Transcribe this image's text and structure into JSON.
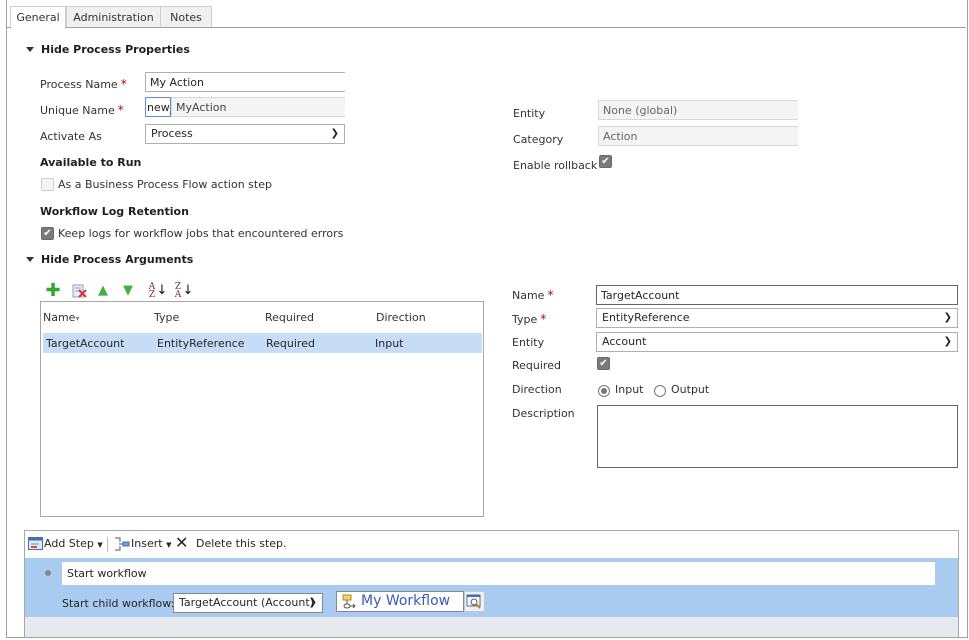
{
  "tabs": [
    {
      "label": "General",
      "active": true
    },
    {
      "label": "Administration",
      "active": false
    },
    {
      "label": "Notes",
      "active": false
    }
  ],
  "process_properties": {
    "section_title": "Hide Process Properties",
    "process_name_label": "Process Name",
    "process_name_value": "My Action",
    "unique_name_label": "Unique Name",
    "unique_name_prefix": "new_",
    "unique_name_value": "MyAction",
    "activate_as_label": "Activate As",
    "activate_as_value": "Process",
    "available_to_run_title": "Available to Run",
    "bpf_action_step_label": "As a Business Process Flow action step",
    "bpf_action_step_checked": false,
    "log_retention_title": "Workflow Log Retention",
    "keep_logs_label": "Keep logs for workflow jobs that encountered errors",
    "keep_logs_checked": true,
    "entity_label": "Entity",
    "entity_value": "None (global)",
    "category_label": "Category",
    "category_value": "Action",
    "enable_rollback_label": "Enable rollback",
    "enable_rollback_checked": true,
    "required_marker": "*"
  },
  "process_arguments": {
    "section_title": "Hide Process Arguments",
    "toolbar_icons": [
      "add-icon",
      "delete-icon",
      "move-up-icon",
      "move-down-icon",
      "sort-ascending-icon",
      "sort-descending-icon"
    ],
    "columns": [
      "Name",
      "Type",
      "Required",
      "Direction"
    ],
    "sort_indicator": "▾",
    "rows": [
      {
        "name": "TargetAccount",
        "type": "EntityReference",
        "required": "Required",
        "direction": "Input"
      }
    ],
    "detail": {
      "name_label": "Name",
      "name_value": "TargetAccount",
      "type_label": "Type",
      "type_value": "EntityReference",
      "entity_label": "Entity",
      "entity_value": "Account",
      "required_label": "Required",
      "required_checked": true,
      "direction_label": "Direction",
      "direction_options": [
        "Input",
        "Output"
      ],
      "direction_selected": "Input",
      "description_label": "Description",
      "description_value": ""
    }
  },
  "steps": {
    "add_step_label": "Add Step",
    "insert_label": "Insert",
    "delete_label": "Delete this step.",
    "step_description": "Start workflow",
    "child_workflow_label": "Start child workflow:",
    "child_workflow_target": "TargetAccount (Account)",
    "child_workflow_name": "My Workflow"
  },
  "colors": {
    "selected_row": "#c7dcf6",
    "step_highlight": "#a9cbef",
    "required_star": "#c00000",
    "lookup_text": "#3b5bb5"
  }
}
